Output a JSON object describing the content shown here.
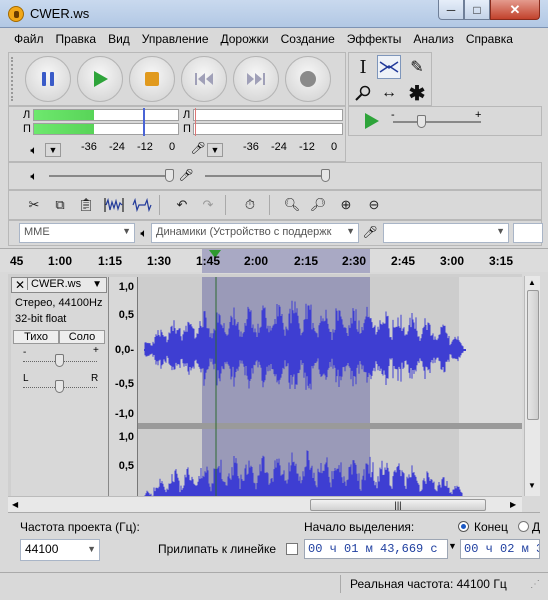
{
  "window": {
    "title": "CWER.ws",
    "min_label": "─",
    "max_label": "□",
    "close_label": "✕"
  },
  "menu": [
    "Файл",
    "Правка",
    "Вид",
    "Управление",
    "Дорожки",
    "Создание",
    "Эффекты",
    "Анализ",
    "Справка"
  ],
  "meters": {
    "left_channel": "Л",
    "right_channel": "П",
    "playback_ticks": [
      "-36",
      "-24",
      "-12",
      "0"
    ],
    "record_ticks": [
      "-36",
      "-24",
      "-12",
      "0"
    ],
    "playback_level": 0.42
  },
  "devices": {
    "host": "MME",
    "output": "Динамики (Устройство с поддержк",
    "input": "",
    "channels": ""
  },
  "timeline": {
    "ticks": [
      "45",
      "1:00",
      "1:15",
      "1:30",
      "1:45",
      "2:00",
      "2:15",
      "2:30",
      "2:45",
      "3:00",
      "3:15"
    ]
  },
  "track": {
    "name": "CWER.ws",
    "format": "Стерео, 44100Hz",
    "bitdepth": "32-bit float",
    "mute_label": "Тихо",
    "solo_label": "Соло",
    "gain_minus": "-",
    "gain_plus": "+",
    "pan_left": "L",
    "pan_right": "R",
    "ruler_top": [
      "1,0",
      "0,5",
      "0,0-",
      "-0,5",
      "-1,0"
    ],
    "ruler_bottom": [
      "1,0",
      "0,5"
    ],
    "wave_color": "#3e3ed2",
    "selection_color": "#9a9ab8"
  },
  "selection_bar": {
    "rate_label": "Частота проекта (Гц):",
    "rate_value": "44100",
    "snap_label": "Прилипать к линейке",
    "sel_start_label": "Начало выделения:",
    "end_label": "Конец",
    "length_label": "Д",
    "start_time": "00 ч 01 м 43,669 с",
    "end_time": "00 ч 02 м 3"
  },
  "status": {
    "actual_rate": "Реальная частота: 44100 Гц"
  }
}
